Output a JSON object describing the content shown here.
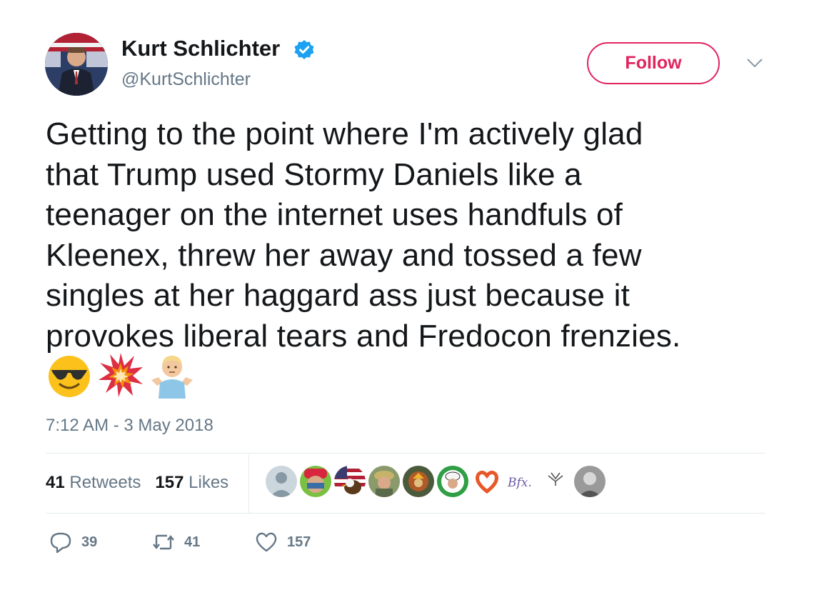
{
  "author": {
    "display_name": "Kurt Schlichter",
    "handle": "@KurtSchlichter",
    "verified_icon": "verified-badge-icon"
  },
  "header": {
    "follow_label": "Follow"
  },
  "tweet": {
    "lines": [
      "Getting to the point where I'm actively glad",
      "that Trump used Stormy Daniels like a",
      "teenager on the internet uses handfuls of",
      "Kleenex, threw her away and tossed a few",
      "singles at her haggard ass just because it",
      "provokes liberal tears and Fredocon frenzies."
    ],
    "emojis": [
      "sunglasses-emoji-icon",
      "collision-emoji-icon",
      "shrug-emoji-icon"
    ],
    "timestamp": "7:12 AM - 3 May 2018"
  },
  "stats": {
    "retweets_count": "41",
    "retweets_label": "Retweets",
    "likes_count": "157",
    "likes_label": "Likes"
  },
  "likers_text": {
    "bfx": "Bfx."
  },
  "actions": {
    "reply_count": "39",
    "retweet_count": "41",
    "like_count": "157"
  },
  "colors": {
    "follow_red": "#e0245e",
    "verified_blue": "#1da1f2",
    "muted_gray": "#657786",
    "text_dark": "#14171a"
  }
}
